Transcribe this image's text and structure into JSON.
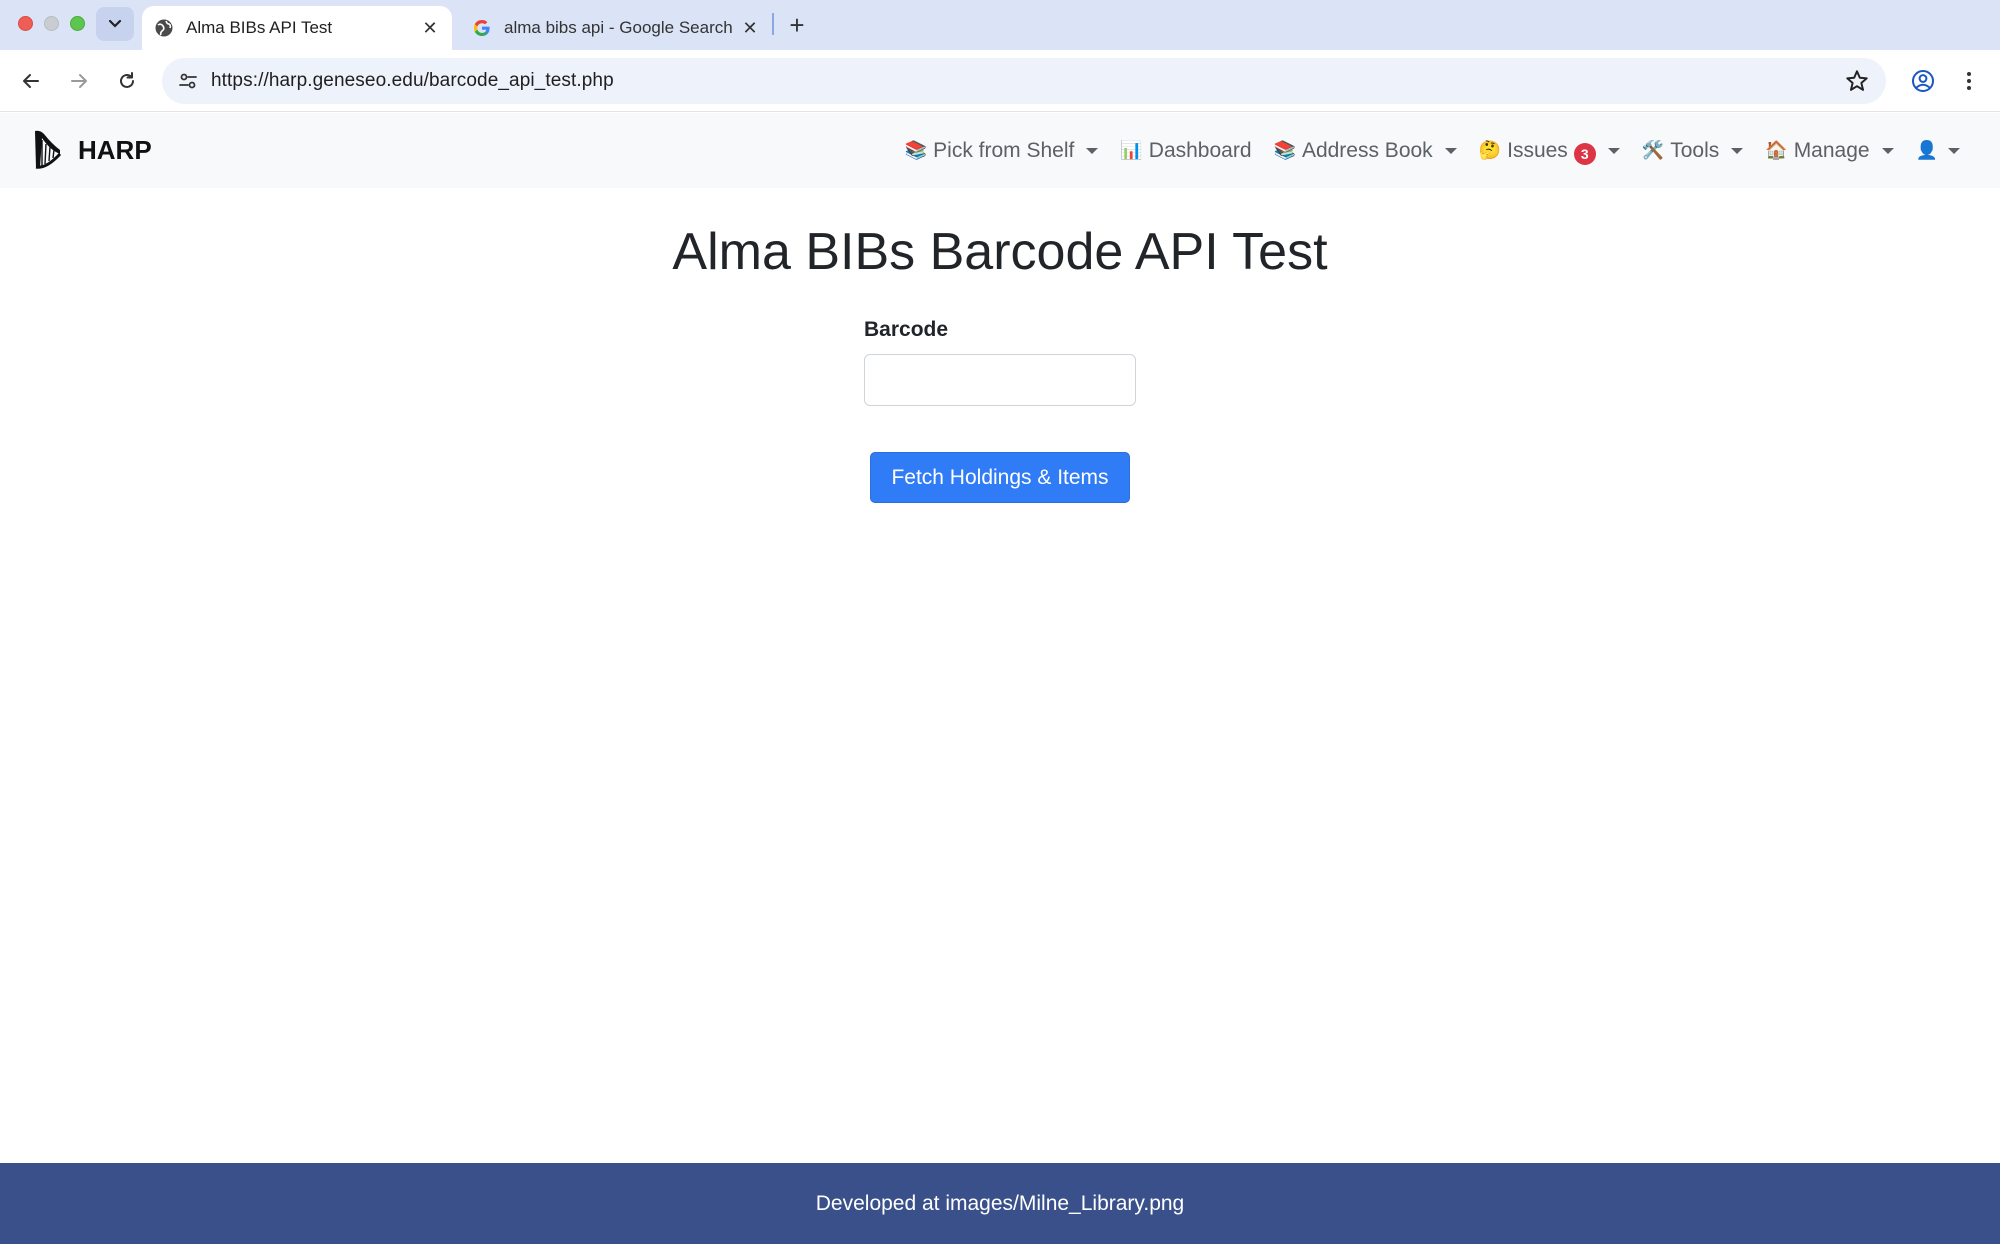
{
  "browser": {
    "tabs": [
      {
        "title": "Alma BIBs API Test",
        "active": true,
        "favicon": "globe-icon"
      },
      {
        "title": "alma bibs api - Google Search",
        "active": false,
        "favicon": "google-icon"
      }
    ],
    "url": "https://harp.geneseo.edu/barcode_api_test.php"
  },
  "navbar": {
    "brand": "HARP",
    "items": [
      {
        "emoji": "📚",
        "label": "Pick from Shelf",
        "dropdown": true
      },
      {
        "emoji": "📊",
        "label": "Dashboard",
        "dropdown": false
      },
      {
        "emoji": "📚",
        "label": "Address Book",
        "dropdown": true
      },
      {
        "emoji": "🤔",
        "label": "Issues",
        "badge": "3",
        "dropdown": true
      },
      {
        "emoji": "🛠️",
        "label": "Tools",
        "dropdown": true
      },
      {
        "emoji": "🏠",
        "label": "Manage",
        "dropdown": true
      },
      {
        "emoji": "👤",
        "label": "",
        "dropdown": true
      }
    ]
  },
  "main": {
    "title": "Alma BIBs Barcode API Test",
    "barcode_label": "Barcode",
    "barcode_value": "",
    "submit_label": "Fetch Holdings & Items"
  },
  "footer": {
    "text": "Developed at images/Milne_Library.png"
  },
  "colors": {
    "accent": "#2f7cf6",
    "footer_bg": "#3a508a",
    "badge": "#dc3545"
  }
}
